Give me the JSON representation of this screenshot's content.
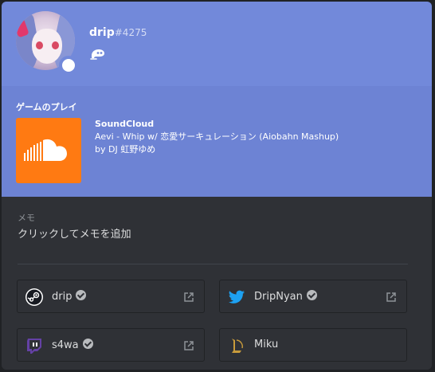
{
  "profile": {
    "username": "drip",
    "discriminator": "#4275",
    "status": "online"
  },
  "activity": {
    "heading": "ゲームのプレイ",
    "app_name": "SoundCloud",
    "details": "Aevi - Whip w/ 恋愛サーキュレーション (Aiobahn Mashup)",
    "state": "by DJ 虹野ゆめ",
    "brand_color": "#ff7a12"
  },
  "note": {
    "label": "メモ",
    "placeholder": "クリックしてメモを追加"
  },
  "connections": [
    {
      "service": "steam",
      "icon": "steam-icon",
      "name": "drip",
      "verified": true
    },
    {
      "service": "twitter",
      "icon": "twitter-icon",
      "name": "DripNyan",
      "verified": true
    },
    {
      "service": "twitch",
      "icon": "twitch-icon",
      "name": "s4wa",
      "verified": true
    },
    {
      "service": "league-of-legends",
      "icon": "league-icon",
      "name": "Miku",
      "verified": false
    }
  ],
  "colors": {
    "header": "#7289da",
    "activity_bg": "#6d83d4",
    "body_bg": "#2f3136",
    "twitter": "#1da1f2",
    "twitch": "#6441a5"
  }
}
